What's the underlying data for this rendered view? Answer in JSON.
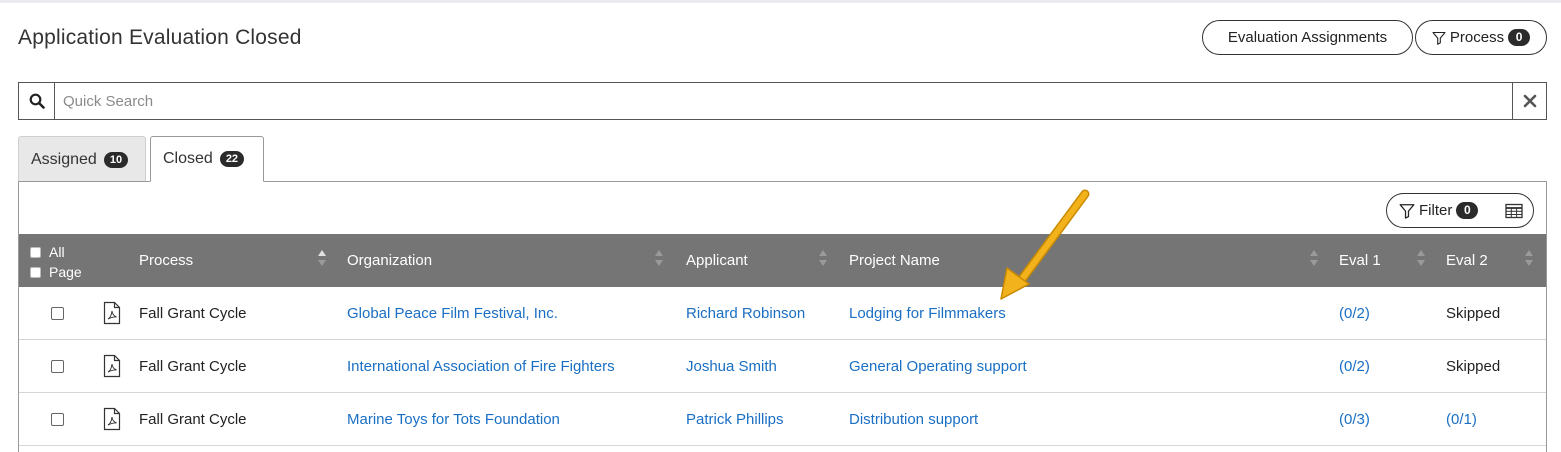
{
  "page": {
    "title": "Application Evaluation Closed"
  },
  "header_buttons": {
    "evaluation_assignments": "Evaluation Assignments",
    "process_label": "Process",
    "process_count": "0"
  },
  "search": {
    "placeholder": "Quick Search"
  },
  "tabs": [
    {
      "label": "Assigned",
      "count": "10",
      "active": false
    },
    {
      "label": "Closed",
      "count": "22",
      "active": true
    }
  ],
  "filter": {
    "label": "Filter",
    "count": "0"
  },
  "table": {
    "select_all_label": "All",
    "select_page_label": "Page",
    "columns": [
      "Process",
      "Organization",
      "Applicant",
      "Project Name",
      "Eval 1",
      "Eval 2"
    ],
    "rows": [
      {
        "process": "Fall Grant Cycle",
        "organization": "Global Peace Film Festival, Inc.",
        "applicant": "Richard Robinson",
        "project": "Lodging for Filmmakers",
        "eval1": "(0/2)",
        "eval2": "Skipped"
      },
      {
        "process": "Fall Grant Cycle",
        "organization": "International Association of Fire Fighters",
        "applicant": "Joshua Smith",
        "project": "General Operating support",
        "eval1": "(0/2)",
        "eval2": "Skipped"
      },
      {
        "process": "Fall Grant Cycle",
        "organization": "Marine Toys for Tots Foundation",
        "applicant": "Patrick Phillips",
        "project": "Distribution support",
        "eval1": "(0/3)",
        "eval2": "(0/1)"
      }
    ]
  },
  "colors": {
    "link": "#1a6fc4",
    "header_bg": "#757575",
    "badge_bg": "#2b2b2b",
    "annotation_arrow": "#f2b21c"
  },
  "icons": {
    "search": "search-icon",
    "clear": "close-icon",
    "filter": "funnel-icon",
    "columns": "table-grid-icon",
    "row_doc": "pdf-document-icon",
    "annotation": "arrow-annotation"
  }
}
